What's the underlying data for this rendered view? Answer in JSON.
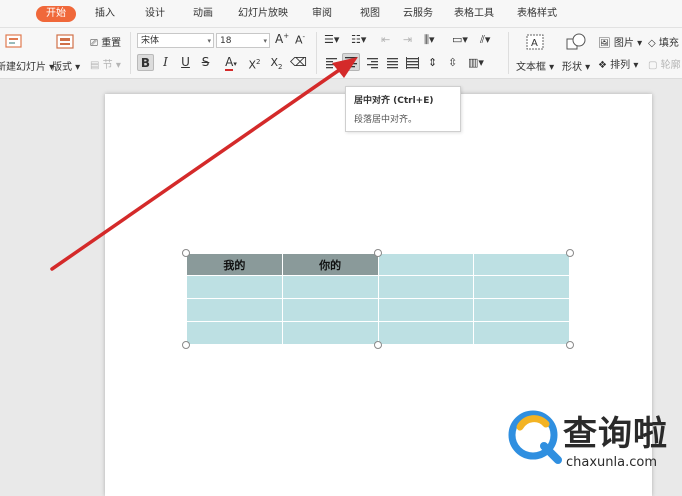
{
  "menu": {
    "tabs": [
      "开始",
      "插入",
      "设计",
      "动画",
      "幻灯片放映",
      "审阅",
      "视图",
      "云服务",
      "表格工具",
      "表格样式"
    ]
  },
  "ribbon": {
    "new_slide_label": "新建幻灯片",
    "layout_label": "版式",
    "reset_label": "重置",
    "section_label": "节",
    "font_name": "宋体",
    "font_size": "18",
    "textbox_label": "文本框",
    "shape_label": "形状",
    "picture_label": "图片",
    "arrange_label": "排列",
    "fill_label": "填充",
    "outline_label": "轮廓"
  },
  "tooltip": {
    "title": "居中对齐 (Ctrl+E)",
    "description": "段落居中对齐。"
  },
  "table": {
    "header": [
      "我的",
      "你的",
      "",
      ""
    ],
    "rows": [
      [
        "",
        "",
        "",
        ""
      ],
      [
        "",
        "",
        "",
        ""
      ],
      [
        "",
        "",
        "",
        ""
      ]
    ]
  },
  "watermark": {
    "text": "查询啦",
    "url": "chaxunla.com"
  },
  "colors": {
    "active_tab": "#f0683a",
    "table_cell": "#bde0e3",
    "table_header": "#8a9a9a",
    "arrow": "#d42a2a"
  }
}
